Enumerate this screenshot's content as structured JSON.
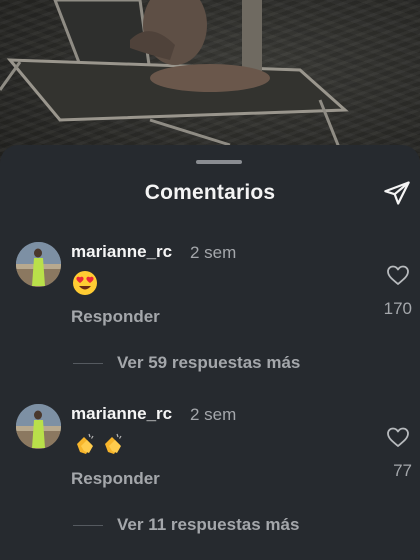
{
  "sheet": {
    "title": "Comentarios",
    "share_icon": "paper-plane-icon"
  },
  "comments": [
    {
      "username": "marianne_rc",
      "time": "2 sem",
      "emojis": [
        "heart-eyes-emoji"
      ],
      "reply_label": "Responder",
      "like_icon": "heart-outline-icon",
      "like_count": "170",
      "view_replies": "Ver 59 respuestas más"
    },
    {
      "username": "marianne_rc",
      "time": "2 sem",
      "emojis": [
        "clapping-hands-emoji",
        "clapping-hands-emoji"
      ],
      "reply_label": "Responder",
      "like_icon": "heart-outline-icon",
      "like_count": "77",
      "view_replies": "Ver 11 respuestas más"
    }
  ],
  "colors": {
    "sheet_bg": "#262a2f",
    "primary_text": "#f5f5f5",
    "secondary_text": "#a4a7ab"
  }
}
